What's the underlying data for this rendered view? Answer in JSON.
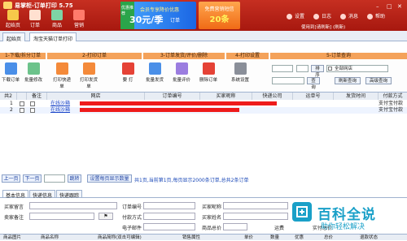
{
  "app": {
    "title": "易掌柜-订单打印 5.75"
  },
  "topnav": [
    {
      "label": "起始页",
      "color": "#f7c84a"
    },
    {
      "label": "订单",
      "color": "#ffe0d0"
    },
    {
      "label": "商品",
      "color": "#7ed3a5"
    },
    {
      "label": "营销",
      "color": "#ff7b6b"
    }
  ],
  "banner1": {
    "tag": "优惠推荐",
    "line1": "会员专享降价优惠",
    "amount": "30元/季",
    "unit": "订单"
  },
  "banner2": {
    "line1": "免费营销短信",
    "amount": "20条"
  },
  "top_right": {
    "settings": "设置",
    "log": "日志",
    "message": "消息",
    "help": "帮助",
    "user_line": "使用到[请刷新]  (刷新)"
  },
  "window_controls": {
    "minimize": "–",
    "maximize": "□",
    "close": "✕"
  },
  "tabs": [
    "起始页",
    "淘宝天猫订单打印"
  ],
  "sections": [
    {
      "label": "1-下载/拆分订单"
    },
    {
      "label": "2-打印订单"
    },
    {
      "label": "3-订单发货/评价/删除"
    },
    {
      "label": "4-打印设置"
    },
    {
      "label": "5-订单查询"
    }
  ],
  "toolbar": [
    {
      "label": "下载订单",
      "color": "#4a8fe8"
    },
    {
      "label": "批量修改",
      "color": "#6cc38b"
    },
    {
      "label": "打印快递单",
      "color": "#f48a3a"
    },
    {
      "label": "打印发货单",
      "color": "#f48a3a"
    },
    {
      "label": "要 打",
      "color": "#e54236"
    },
    {
      "label": "批量发货",
      "color": "#4a8fe8"
    },
    {
      "label": "批量评价",
      "color": "#9b7de0"
    },
    {
      "label": "删除订单",
      "color": "#e54236"
    },
    {
      "label": "系统设置",
      "color": "#8a8f99"
    }
  ],
  "query": {
    "shop": "全部网店",
    "sort_label": "排序",
    "query_label": "查询",
    "refresh_query": "刷新查询",
    "advanced_query": "高级查询",
    "select_placeholder": "5"
  },
  "grid": {
    "total_label": "共2",
    "columns": [
      "备注",
      "网店",
      "订单编号",
      "买家昵称",
      "快递公司",
      "运单号",
      "发货时间",
      "付款方式"
    ],
    "rows": [
      {
        "num": "1",
        "shop": "在线沙箱",
        "payment": "支付宝付款"
      },
      {
        "num": "2",
        "shop": "在线沙箱",
        "payment": "支付宝付款"
      }
    ]
  },
  "pager": {
    "prev": "上一页",
    "next": "下一页",
    "jump": "跳转",
    "per_page": "设置每页显示数量",
    "info": "共1页,当前第1页,每页显示2000条订单,总共2条订单"
  },
  "detail_tabs": [
    "基本信息",
    "快递信息",
    "快递跟踪"
  ],
  "detail_fields": {
    "buyer_msg": "买家留言",
    "seller_note": "卖家备注",
    "order_no": "订单编号",
    "pay_method": "付款方式",
    "email": "电子邮件",
    "buyer_nick": "买家昵称",
    "buyer_name": "买家姓名",
    "goods_total": "商品总价",
    "freight": "运费",
    "paid_total": "实付总价"
  },
  "bottom_columns": [
    "商品图片",
    "商品名称",
    "商品简称(双击可编辑)",
    "销售属性",
    "单价",
    "数量",
    "优惠",
    "总价",
    "退款状态"
  ],
  "watermark": {
    "title": "百科全说",
    "subtitle": "助你轻松解决"
  }
}
